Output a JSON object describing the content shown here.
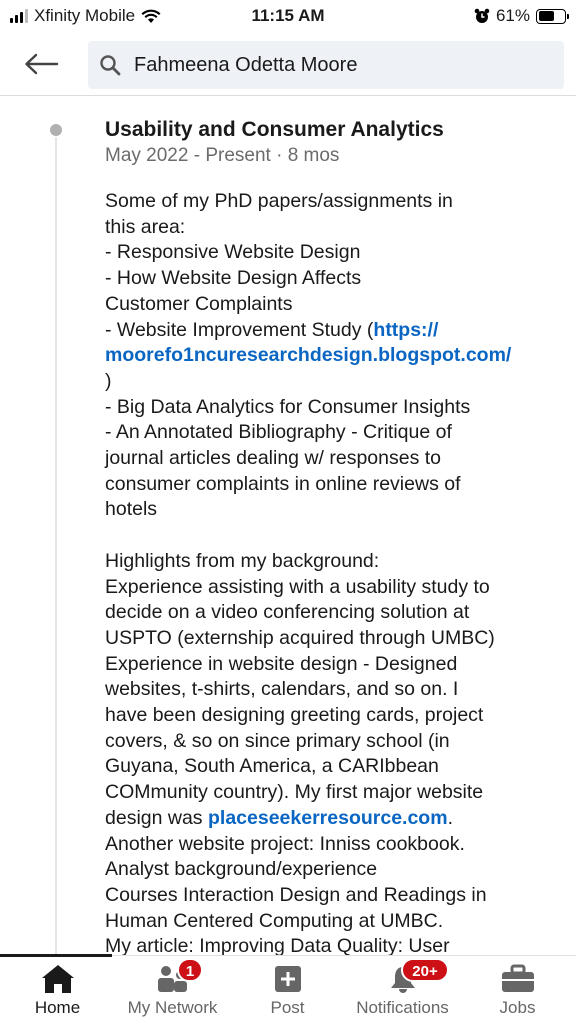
{
  "status_bar": {
    "carrier": "Xfinity Mobile",
    "time": "11:15 AM",
    "battery_percent": "61%",
    "battery_level": 0.61
  },
  "header": {
    "back_icon": "arrow-left-icon",
    "search_icon": "search-icon",
    "search_value": "Fahmeena Odetta Moore"
  },
  "experience": {
    "title": "Usability and Consumer Analytics",
    "dates": "May 2022 - Present · 8 mos",
    "body_lines": [
      "Some of my PhD papers/assignments in",
      "this area:",
      "- Responsive Website Design",
      "- How Website Design Affects",
      "Customer Complaints",
      "- Website Improvement Study (",
      "https://",
      "moorefo1ncuresearchdesign.blogspot.com/",
      ")",
      "- Big Data Analytics for Consumer Insights",
      "- An Annotated Bibliography - Critique of",
      "journal articles dealing w/ responses to",
      "consumer complaints in online reviews of",
      "hotels",
      "Highlights from my background:",
      "Experience assisting with a usability study to",
      "decide on a video conferencing solution at",
      "USPTO (externship acquired through UMBC)",
      "Experience in website design - Designed",
      "websites, t-shirts, calendars, and so on. I",
      "have been designing greeting cards, project",
      "covers, & so on since primary school (in",
      "Guyana, South America, a CARIbbean",
      "COMmunity country). My first major website",
      "design was ",
      "placeseekerresource.com",
      ".",
      "Another website project: Inniss cookbook.",
      "Analyst background/experience",
      "Courses Interaction Design and Readings in",
      "Human Centered Computing at UMBC.",
      "My article: Improving Data Quality: User"
    ]
  },
  "bottom_nav": {
    "items": [
      {
        "label": "Home",
        "icon": "home-icon"
      },
      {
        "label": "My Network",
        "icon": "network-icon",
        "badge": "1"
      },
      {
        "label": "Post",
        "icon": "post-plus-icon"
      },
      {
        "label": "Notifications",
        "icon": "bell-icon",
        "badge": "20+"
      },
      {
        "label": "Jobs",
        "icon": "briefcase-icon"
      }
    ]
  },
  "colors": {
    "link": "#0a66c2",
    "badge": "#cc1016",
    "search_bg": "#eef2f7"
  }
}
